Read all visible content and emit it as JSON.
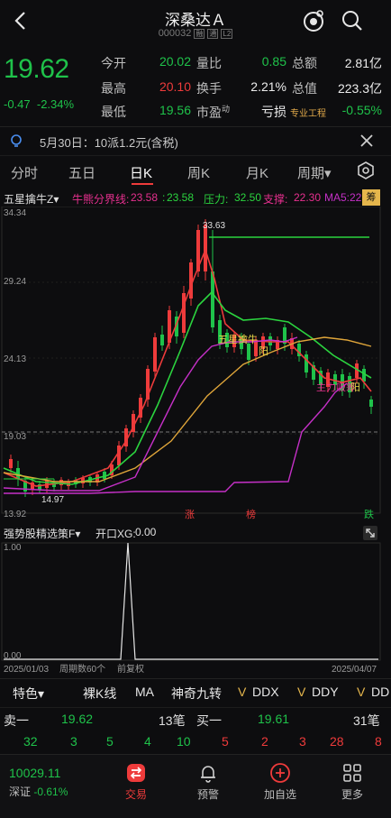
{
  "header": {
    "title": "深桑达Ａ",
    "code": "000032",
    "badge1": "融",
    "badge2": "通",
    "badge3": "L2"
  },
  "quote": {
    "price": "19.62",
    "change": "-0.47",
    "change_pct": "-2.34%",
    "open_label": "今开",
    "open": "20.02",
    "high_label": "最高",
    "high": "20.10",
    "low_label": "最低",
    "low": "19.56",
    "vol_ratio_label": "量比",
    "vol_ratio": "0.85",
    "turnover_label": "换手",
    "turnover": "2.21%",
    "pe_label": "市盈",
    "pe_sup": "动",
    "pe": "亏损",
    "amount_label": "总额",
    "amount": "2.81亿",
    "mktcap_label": "总值",
    "mktcap": "223.3亿",
    "industry_label": "专业工程",
    "industry_chg": "-0.55%"
  },
  "notice": {
    "text": "5月30日：10派1.2元(含税)"
  },
  "tabs": [
    "分时",
    "五日",
    "日K",
    "周K",
    "月K",
    "周期▾"
  ],
  "indicators": {
    "main_name": "五星擒牛Z▾",
    "bull_label": "牛熊分界线:",
    "bull_val1": "23.58",
    "bull_val2": "23.58",
    "press_label": "压力:",
    "press_val": "32.50",
    "support_label": "支撑:",
    "support_val": "22.30",
    "ma5_label": "MA5:22",
    "chip": "筹"
  },
  "kchart": {
    "y_labels": [
      "34.34",
      "29.24",
      "24.13",
      "19.03",
      "13.92"
    ],
    "high_mark": "33.63",
    "low_mark": "14.97",
    "current_line": "19.62",
    "signal_labels": [
      "五星擒牛",
      "阳",
      "主力吸筹",
      "阳"
    ],
    "bottom_tags": [
      "涨",
      "榜",
      "跌"
    ],
    "colors": {
      "up": "#ee3b3b",
      "down": "#1fc24a",
      "ma_green": "#2bd43f",
      "ma_orange": "#e0a63a",
      "ma_magenta": "#c530c7",
      "resist": "#2bd43f"
    }
  },
  "subchart": {
    "name": "强势股精选策F▾",
    "xg_label": "开口XG:",
    "xg_val": "0.00",
    "y_top": "1.00",
    "y_bottom": "0.00",
    "date_start": "2025/01/03",
    "period_label": "周期数60个",
    "adjust_label": "前复权",
    "date_end": "2025/04/07"
  },
  "toolbar": [
    "特色▾",
    "裸K线",
    "MA",
    "神奇九转",
    "DDX",
    "DDY",
    "DD"
  ],
  "book": {
    "sell_label": "卖一",
    "sell_price": "19.62",
    "sell_qty": "13笔",
    "buy_label": "买一",
    "buy_price": "19.61",
    "buy_qty": "31笔",
    "sell_ticks": [
      "32",
      "3",
      "5",
      "4",
      "10"
    ],
    "buy_ticks": [
      "5",
      "2",
      "3",
      "28",
      "8"
    ]
  },
  "nav": {
    "index_val": "10029.11",
    "index_name": "深证",
    "index_chg": "-0.61%",
    "items": [
      "交易",
      "预警",
      "加自选",
      "更多"
    ]
  }
}
